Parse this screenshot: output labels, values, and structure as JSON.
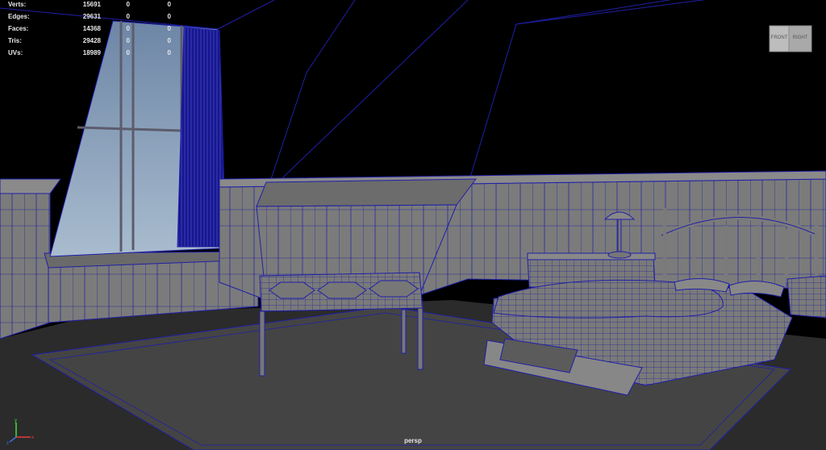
{
  "hud": {
    "rows": [
      {
        "label": "Verts:",
        "value": "15691",
        "sel1": "0",
        "sel2": "0"
      },
      {
        "label": "Edges:",
        "value": "29631",
        "sel1": "0",
        "sel2": "0"
      },
      {
        "label": "Faces:",
        "value": "14368",
        "sel1": "0",
        "sel2": "0"
      },
      {
        "label": "Tris:",
        "value": "29428",
        "sel1": "0",
        "sel2": "0"
      },
      {
        "label": "UVs:",
        "value": "18989",
        "sel1": "0",
        "sel2": "0"
      }
    ]
  },
  "viewcube": {
    "front_label": "FRONT",
    "right_label": "RIGHT"
  },
  "axis": {
    "x_label": "x",
    "y_label": "y",
    "z_label": "z"
  },
  "camera": {
    "label": "persp"
  },
  "colors": {
    "background": "#000000",
    "wireframe": "#1f1fa8",
    "wall": "#7a7a7a",
    "floor": "#2e2e2e",
    "rug": "#444444",
    "window_sky": "#8ea3bd",
    "curtain": "#1a1a9a"
  }
}
